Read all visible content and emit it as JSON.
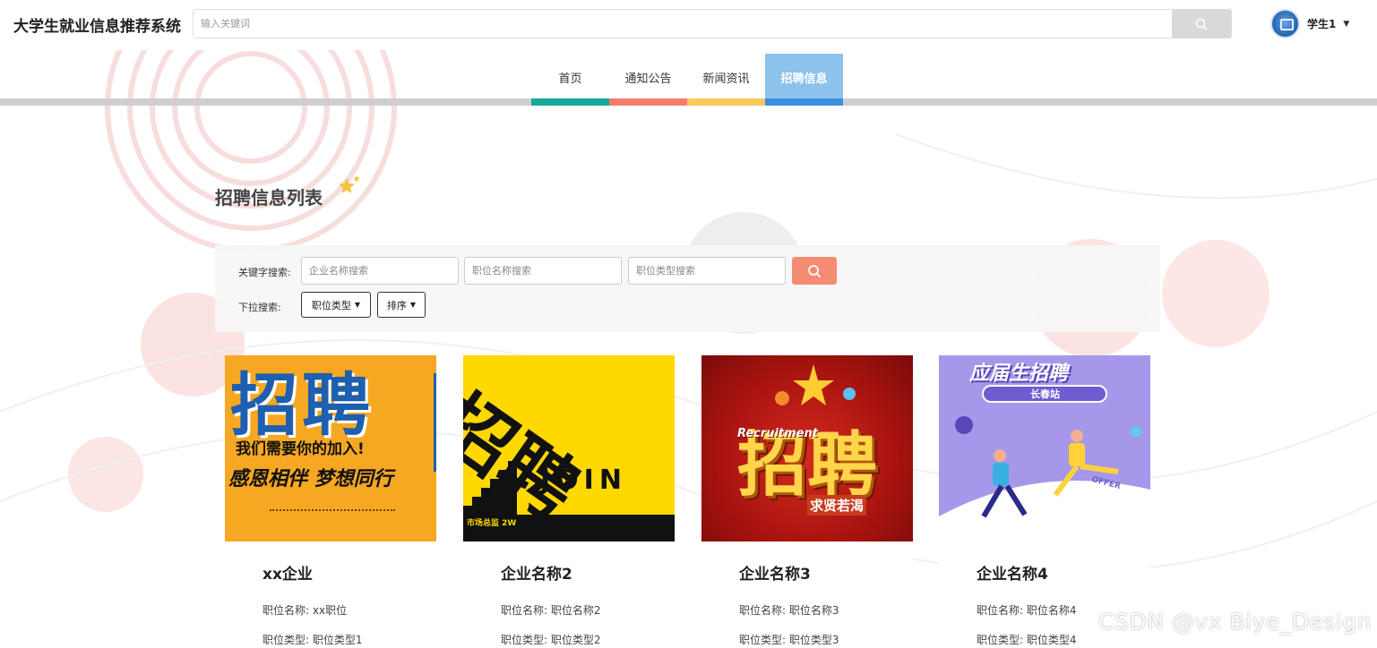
{
  "header": {
    "site_title": "大学生就业信息推荐系统",
    "search_placeholder": "输入关键词",
    "user_name": "学生1"
  },
  "nav": {
    "items": [
      {
        "label": "首页",
        "color": "#17a99a"
      },
      {
        "label": "通知公告",
        "color": "#f47d69"
      },
      {
        "label": "新闻资讯",
        "color": "#f9c95c"
      },
      {
        "label": "招聘信息",
        "color": "#3b8fdc",
        "active": true
      }
    ]
  },
  "page": {
    "title": "招聘信息列表"
  },
  "filters": {
    "keyword_label": "关键字搜索:",
    "company_placeholder": "企业名称搜索",
    "position_placeholder": "职位名称搜索",
    "type_placeholder": "职位类型搜索",
    "dropdown_label": "下拉搜索:",
    "type_dropdown": "职位类型",
    "sort_dropdown": "排序"
  },
  "cards": [
    {
      "company": "xx企业",
      "position_key": "职位名称:",
      "position": "xx职位",
      "type_key": "职位类型:",
      "type": "职位类型1",
      "poster": {
        "main": "招聘",
        "line1": "我们需要你的加入!",
        "line2": "感恩相伴 梦想同行"
      }
    },
    {
      "company": "企业名称2",
      "position_key": "职位名称:",
      "position": "职位名称2",
      "type_key": "职位类型:",
      "type": "职位类型2",
      "poster": {
        "main": "招聘",
        "line1": "JOIN",
        "line2": "市场总监 2W"
      }
    },
    {
      "company": "企业名称3",
      "position_key": "职位名称:",
      "position": "职位名称3",
      "type_key": "职位类型:",
      "type": "职位类型3",
      "poster": {
        "main": "招聘",
        "line1": "Recruitment",
        "line2": "求贤若渴"
      }
    },
    {
      "company": "企业名称4",
      "position_key": "职位名称:",
      "position": "职位名称4",
      "type_key": "职位类型:",
      "type": "职位类型4",
      "poster": {
        "main": "应届生招聘",
        "line1": "长春站",
        "line2": "OFFER"
      }
    }
  ],
  "watermark": "CSDN @vx Biye_Design",
  "colors": {
    "search_button": "#f68b73",
    "active_nav": "#8cc2ec"
  }
}
